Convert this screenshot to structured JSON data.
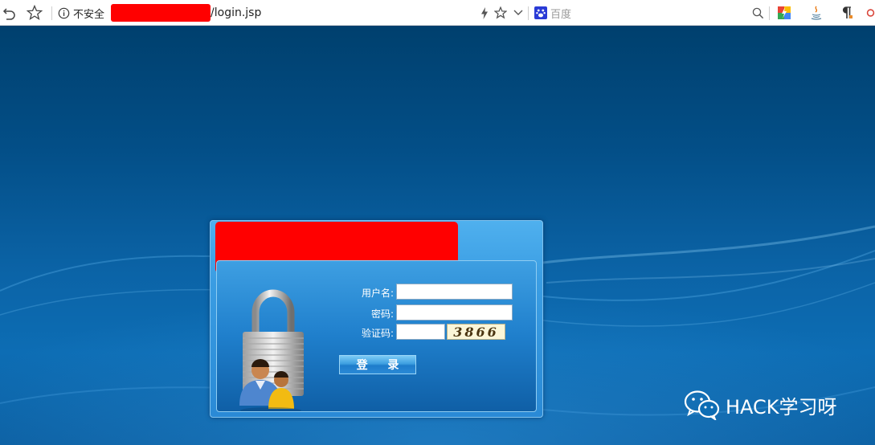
{
  "browser": {
    "security_label": "不安全",
    "url_path": "/login.jsp",
    "search_engine": "百度"
  },
  "login": {
    "username_label": "用户名:",
    "username_value": "",
    "password_label": "密码:",
    "password_value": "",
    "captcha_label": "验证码:",
    "captcha_value": "",
    "captcha_text": "3866",
    "submit_label": "登 录"
  },
  "watermark": {
    "text": "HACK学习呀"
  },
  "colors": {
    "redaction": "#ff0000",
    "page_bg": "#0a4f86",
    "panel_blue": "#3a9de3"
  }
}
